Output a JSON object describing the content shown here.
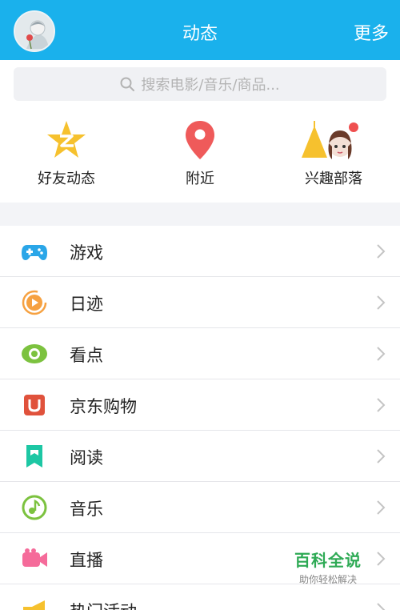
{
  "header": {
    "title": "动态",
    "more_label": "更多"
  },
  "search": {
    "placeholder": "搜索电影/音乐/商品..."
  },
  "quick_actions": [
    {
      "label": "好友动态",
      "icon": "qzone-star-icon"
    },
    {
      "label": "附近",
      "icon": "location-pin-icon"
    },
    {
      "label": "兴趣部落",
      "icon": "tribe-tent-icon"
    }
  ],
  "menu": [
    {
      "label": "游戏",
      "icon": "gamepad-icon",
      "color": "#2aa6e8"
    },
    {
      "label": "日迹",
      "icon": "play-circle-icon",
      "color": "#f6a141"
    },
    {
      "label": "看点",
      "icon": "eye-icon",
      "color": "#7cc23f"
    },
    {
      "label": "京东购物",
      "icon": "jd-shopping-icon",
      "color": "#e0523c"
    },
    {
      "label": "阅读",
      "icon": "book-icon",
      "color": "#1dc7a4"
    },
    {
      "label": "音乐",
      "icon": "music-icon",
      "color": "#7cc23f"
    },
    {
      "label": "直播",
      "icon": "video-camera-icon",
      "color": "#f56b9a"
    },
    {
      "label": "热门活动",
      "icon": "megaphone-icon",
      "color": "#f6c12e"
    }
  ],
  "watermark": {
    "title": "百科全说",
    "subtitle": "助你轻松解决"
  },
  "colors": {
    "header": "#1ab1ec",
    "badge": "#ef4f4f"
  }
}
